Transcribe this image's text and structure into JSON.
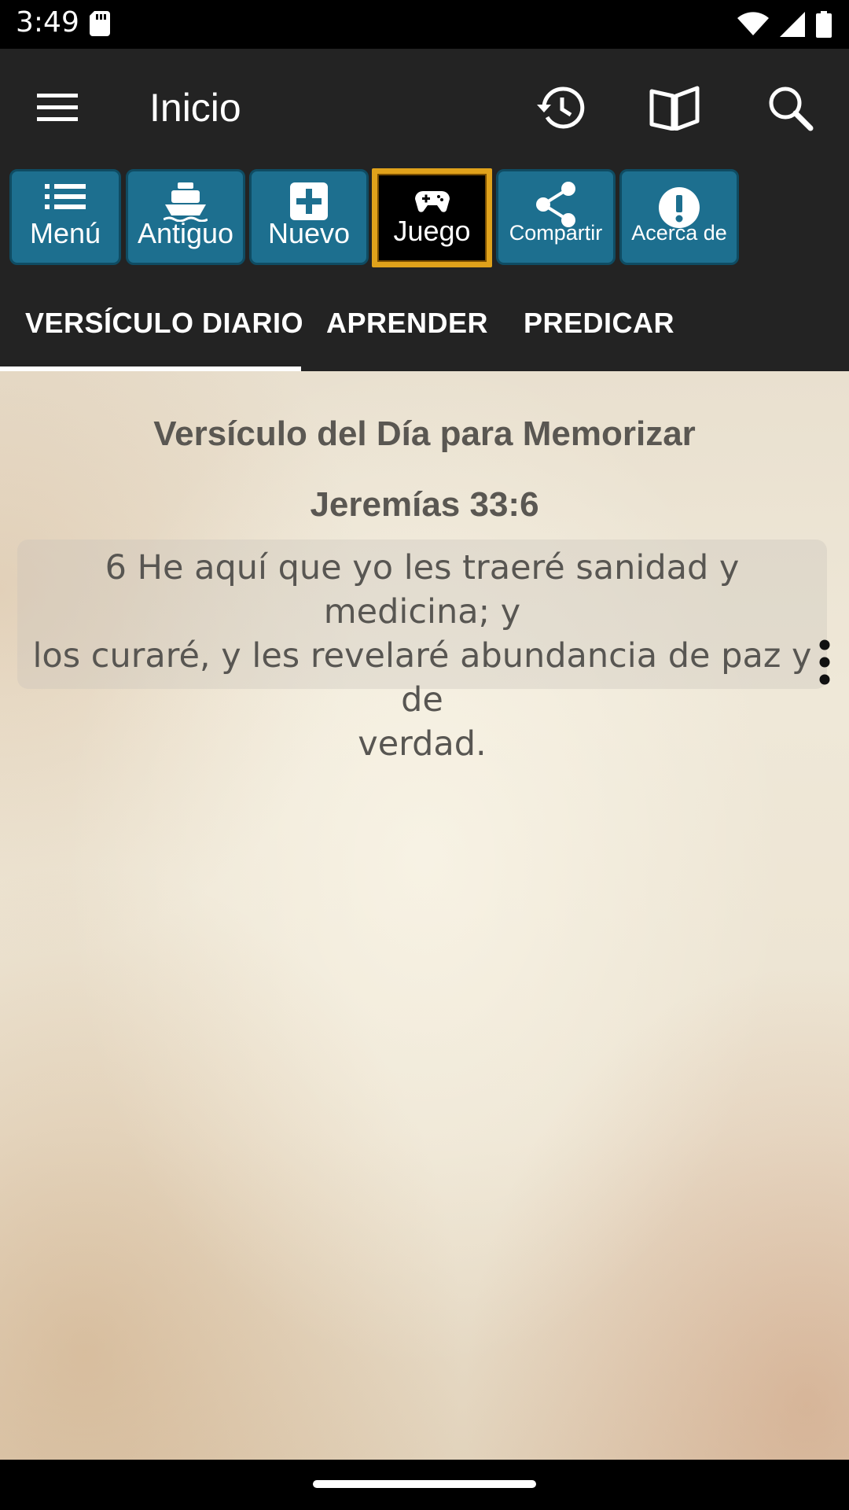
{
  "status_bar": {
    "time": "3:49"
  },
  "app_bar": {
    "title": "Inicio"
  },
  "toolbar": {
    "buttons": [
      {
        "label": "Menú",
        "icon": "list-icon"
      },
      {
        "label": "Antiguo",
        "icon": "ship-icon"
      },
      {
        "label": "Nuevo",
        "icon": "plus-box-icon"
      },
      {
        "label": "Juego",
        "icon": "gamepad-icon"
      },
      {
        "label": "Compartir",
        "icon": "share-icon"
      },
      {
        "label": "Acerca de",
        "icon": "info-circle-icon"
      }
    ]
  },
  "tabs": [
    {
      "label": "VERSÍCULO DIARIO",
      "active": true
    },
    {
      "label": "APRENDER",
      "active": false
    },
    {
      "label": "PREDICAR",
      "active": false
    }
  ],
  "verse": {
    "heading": "Versículo del Día para Memorizar",
    "reference": "Jeremías 33:6",
    "text_lines": [
      "6 He aquí que yo les traeré sanidad y medicina; y",
      "los curaré, y les revelaré abundancia de paz y de",
      "verdad."
    ]
  },
  "colors": {
    "app_bar": "#232323",
    "toolbar_button": "#1d6f8f",
    "game_border": "#e0a21b",
    "parchment": "#ece3d1"
  }
}
